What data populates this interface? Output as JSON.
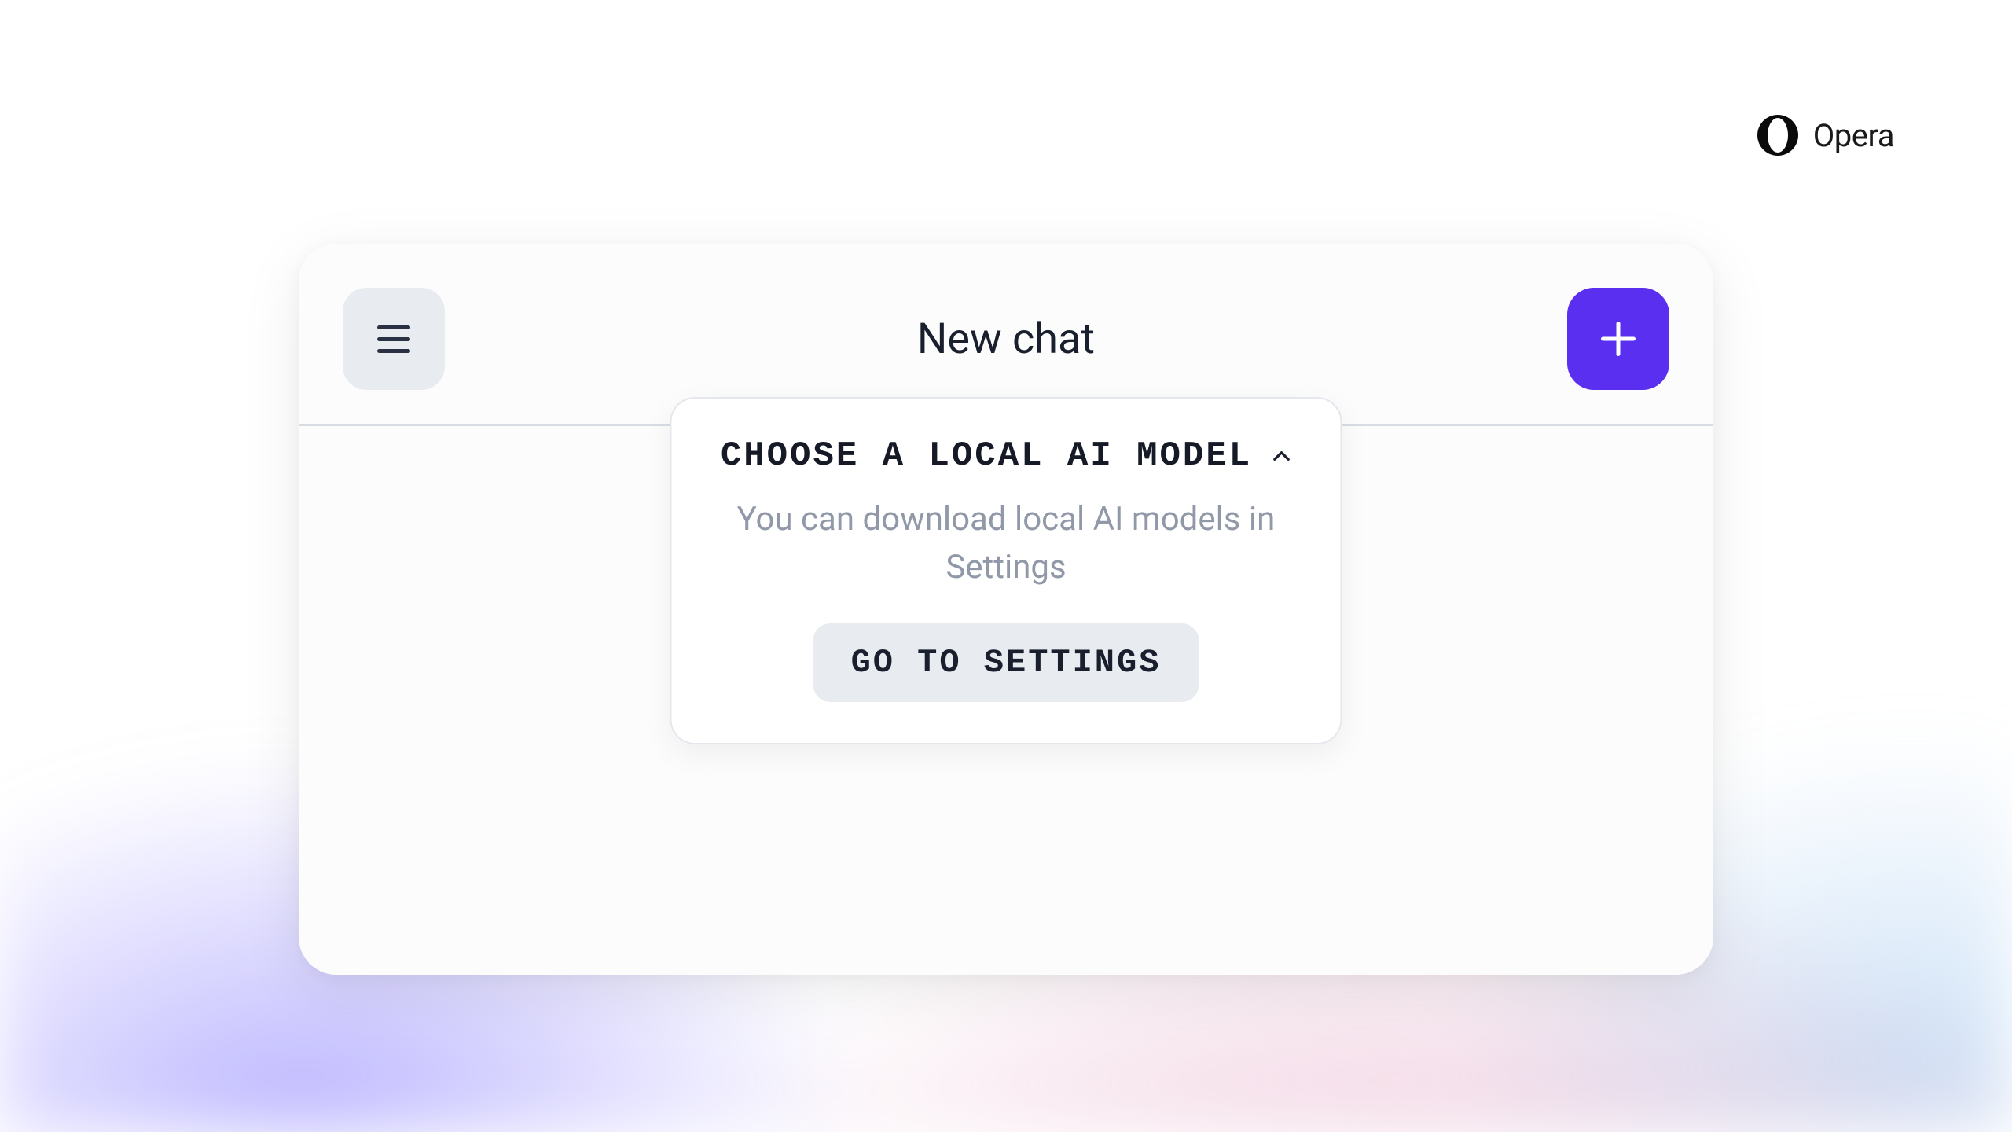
{
  "brand": {
    "name": "Opera"
  },
  "header": {
    "title": "New chat"
  },
  "dropdown": {
    "title": "CHOOSE A LOCAL AI MODEL",
    "description": "You can download local AI models in Settings",
    "button_label": "GO TO SETTINGS"
  },
  "colors": {
    "accent": "#5b2ff0",
    "card_bg": "#fcfcfd",
    "btn_grey": "#e8ebef",
    "text_dark": "#1a1f2e",
    "text_muted": "#9199a8"
  }
}
